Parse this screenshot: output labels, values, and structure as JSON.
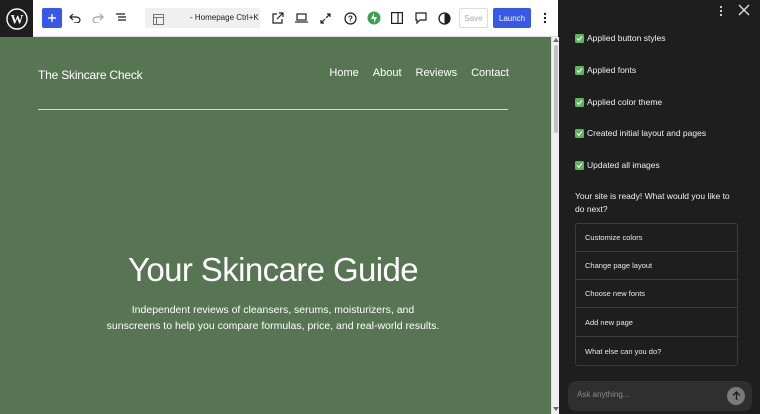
{
  "toolbar": {
    "doc_title": "- Homepage Ctrl+K",
    "save_label": "Save",
    "launch_label": "Launch"
  },
  "site": {
    "title": "The Skincare Check",
    "nav": [
      "Home",
      "About",
      "Reviews",
      "Contact"
    ],
    "hero_title": "Your Skincare Guide",
    "hero_sub_line1": "Independent reviews of cleansers, serums, moisturizers, and",
    "hero_sub_line2": "sunscreens to help you compare formulas, price, and real-world results."
  },
  "assistant": {
    "steps": [
      "Applied button styles",
      "Applied fonts",
      "Applied color theme",
      "Created initial layout and pages",
      "Updated all images"
    ],
    "ready_line1": "Your site is ready! What would you like to",
    "ready_line2": "do next?",
    "suggestions": [
      "Customize colors",
      "Change page layout",
      "Choose new fonts",
      "Add new page",
      "What else can you do?"
    ],
    "ask_placeholder": "Ask anything..."
  },
  "colors": {
    "accent": "#3858e9",
    "canvas_bg": "#577553",
    "panel_bg": "#1e1e1e",
    "check_green": "#5bb85d"
  }
}
